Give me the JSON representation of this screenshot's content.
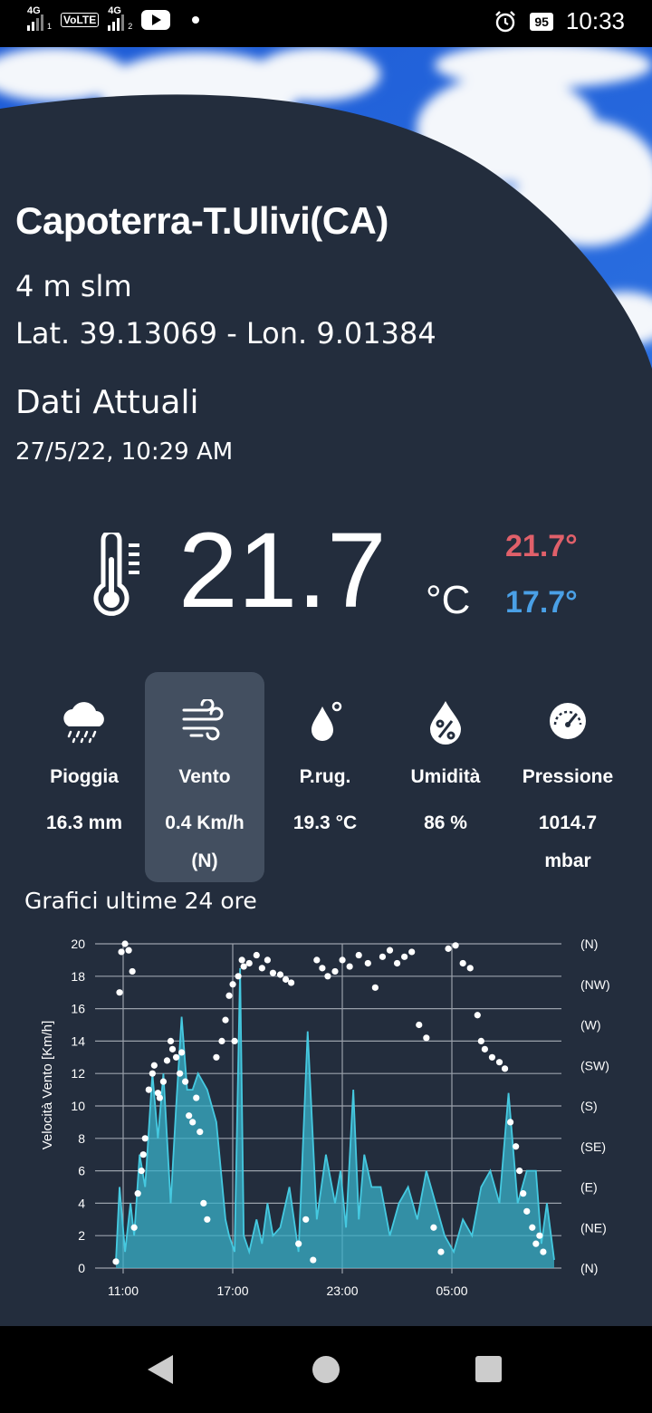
{
  "status_bar": {
    "sim1": "4G",
    "sim1_slot": "1",
    "volte": "VoLTE",
    "sim2": "4G",
    "sim2_slot": "2",
    "battery": "95",
    "time": "10:33"
  },
  "station": {
    "name": "Capoterra-T.Ulivi(CA)",
    "altitude": "4 m slm",
    "coordinates": "Lat. 39.13069 - Lon. 9.01384"
  },
  "current": {
    "section_title": "Dati Attuali",
    "datetime": "27/5/22, 10:29 AM",
    "temperature": "21.7",
    "unit": "°C",
    "max": "21.7°",
    "min": "17.7°"
  },
  "metrics": [
    {
      "label": "Pioggia",
      "value": "16.3 mm",
      "icon": "rain-cloud-icon",
      "active": false
    },
    {
      "label": "Vento",
      "value": "0.4 Km/h",
      "value2": "(N)",
      "icon": "wind-icon",
      "active": true
    },
    {
      "label": "P.rug.",
      "value": "19.3 °C",
      "icon": "dew-drop-icon",
      "active": false
    },
    {
      "label": "Umidità",
      "value": "86 %",
      "icon": "humidity-drop-icon",
      "active": false
    },
    {
      "label": "Pressione",
      "value": "1014.7",
      "value2": "mbar",
      "icon": "gauge-icon",
      "active": false
    }
  ],
  "chart_section_title": "Grafici ultime 24 ore",
  "colors": {
    "background": "#232d3d",
    "active_tile": "#434f60",
    "max_temp": "#e0606a",
    "min_temp": "#4aa0e6",
    "wind_area": "#3ab0c8",
    "wind_line": "#45c9e0",
    "direction_dots": "#ffffff"
  },
  "chart_data": {
    "type": "area",
    "title": "",
    "xlabel": "",
    "ylabel": "Velocità Vento [Km/h]",
    "ylim": [
      0,
      20
    ],
    "yticks": [
      "0",
      "2",
      "4",
      "6",
      "8",
      "10",
      "12",
      "14",
      "16",
      "18",
      "20"
    ],
    "x_tick_labels": [
      "11:00",
      "17:00",
      "23:00",
      "05:00"
    ],
    "right_axis_labels": [
      "(N)",
      "(NW)",
      "(W)",
      "(SW)",
      "(S)",
      "(SE)",
      "(E)",
      "(NE)",
      "(N)"
    ],
    "grid": true,
    "series": [
      {
        "kind": "area",
        "hours": [
          0,
          0.2,
          0.5,
          0.8,
          1,
          1.3,
          1.6,
          2,
          2.3,
          2.6,
          3,
          3.3,
          3.6,
          3.9,
          4.2,
          4.5,
          5,
          5.5,
          6,
          6.2,
          6.5,
          6.8,
          7,
          7.3,
          7.7,
          8,
          8.3,
          8.6,
          9,
          9.5,
          10,
          10.5,
          11,
          11.5,
          12,
          12.3,
          12.6,
          13,
          13.3,
          13.6,
          14,
          14.5,
          15,
          15.5,
          16,
          16.5,
          17,
          17.5,
          18,
          18.5,
          19,
          19.5,
          20,
          20.5,
          21,
          21.5,
          22,
          22.5,
          23,
          23.3,
          23.6,
          24
        ],
        "values": [
          0.4,
          5,
          1,
          4,
          2,
          7,
          5,
          12,
          8,
          12,
          4,
          10,
          15.5,
          11,
          11,
          12,
          11,
          9,
          3,
          2,
          1,
          18.5,
          2,
          1,
          3,
          1.5,
          4,
          2,
          2.5,
          5,
          1,
          14.6,
          3,
          7,
          4,
          6,
          2.5,
          11,
          3,
          7,
          5,
          5,
          2,
          4,
          5,
          3,
          6,
          4,
          2,
          1,
          3,
          2,
          5,
          6,
          4,
          10.8,
          4,
          6,
          6,
          1.5,
          4,
          0.5
        ]
      },
      {
        "kind": "scatter",
        "name_on_right_axis": "direction",
        "hours": [
          0,
          0.2,
          0.3,
          0.5,
          0.7,
          0.9,
          1,
          1.2,
          1.4,
          1.5,
          1.6,
          1.8,
          2,
          2.1,
          2.3,
          2.4,
          2.6,
          2.8,
          3,
          3.1,
          3.3,
          3.5,
          3.6,
          3.8,
          4,
          4.2,
          4.4,
          4.6,
          4.8,
          5,
          5.5,
          5.8,
          6,
          6.2,
          6.4,
          6.5,
          6.7,
          6.9,
          7,
          7.3,
          7.7,
          8,
          8.3,
          8.6,
          9,
          9.3,
          9.6,
          10,
          10.4,
          10.8,
          11,
          11.3,
          11.6,
          12,
          12.4,
          12.8,
          13.3,
          13.8,
          14.2,
          14.6,
          15,
          15.4,
          15.8,
          16.2,
          16.6,
          17,
          17.4,
          17.8,
          18.2,
          18.6,
          19,
          19.4,
          19.8,
          20,
          20.2,
          20.6,
          21,
          21.3,
          21.6,
          21.9,
          22.1,
          22.3,
          22.5,
          22.8,
          23,
          23.2,
          23.4
        ],
        "values": [
          0.4,
          17,
          19.5,
          20,
          19.6,
          18.3,
          2.5,
          4.6,
          6,
          7,
          8,
          11,
          12,
          12.5,
          10.8,
          10.5,
          11.5,
          12.8,
          14,
          13.5,
          13,
          12,
          13.3,
          11.5,
          9.4,
          9,
          10.5,
          8.4,
          4,
          3,
          13,
          14,
          15.3,
          16.8,
          17.5,
          14,
          18,
          19,
          18.6,
          18.8,
          19.3,
          18.5,
          19,
          18.2,
          18.1,
          17.8,
          17.6,
          1.5,
          3,
          0.5,
          19,
          18.5,
          18,
          18.3,
          19,
          18.6,
          19.3,
          18.8,
          17.3,
          19.2,
          19.6,
          18.8,
          19.2,
          19.5,
          15,
          14.2,
          2.5,
          1,
          19.7,
          19.9,
          18.8,
          18.5,
          15.6,
          14,
          13.5,
          13,
          12.7,
          12.3,
          9,
          7.5,
          6,
          4.6,
          3.5,
          2.5,
          1.5,
          2,
          1
        ]
      }
    ]
  }
}
